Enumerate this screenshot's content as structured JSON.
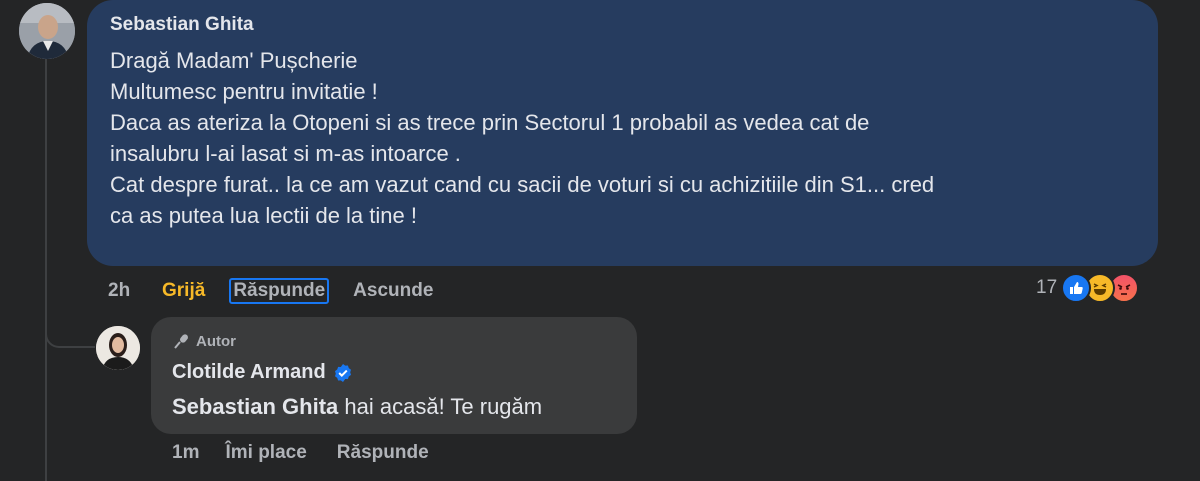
{
  "comment1": {
    "author": "Sebastian Ghita",
    "lines": [
      "Dragă Madam' Pușcherie",
      "Multumesc pentru invitatie !",
      "Daca as ateriza la Otopeni si as trece prin Sectorul 1 probabil as vedea cat de",
      "insalubru l-ai lasat si m-as intoarce .",
      "Cat despre furat.. la ce am vazut cand cu sacii de voturi si cu achizitiile din S1... cred",
      "ca as putea lua lectii de la tine !"
    ],
    "time": "2h",
    "reaction_label": "Grijă",
    "reply_label": "Răspunde",
    "hide_label": "Ascunde",
    "reaction_count": "17",
    "reaction_icons": [
      "like-icon",
      "haha-icon",
      "angry-icon"
    ],
    "bubble_color": "#263c5f"
  },
  "comment2": {
    "badge": "Autor",
    "author": "Clotilde Armand",
    "mention": "Sebastian Ghita",
    "text": " hai acasă! Te rugăm",
    "time": "1m",
    "like_label": "Îmi place",
    "reply_label": "Răspunde",
    "bubble_color": "#3a3b3c"
  },
  "colors": {
    "background": "#242526",
    "care_reaction": "#f7b928",
    "verified": "#1877f2"
  }
}
